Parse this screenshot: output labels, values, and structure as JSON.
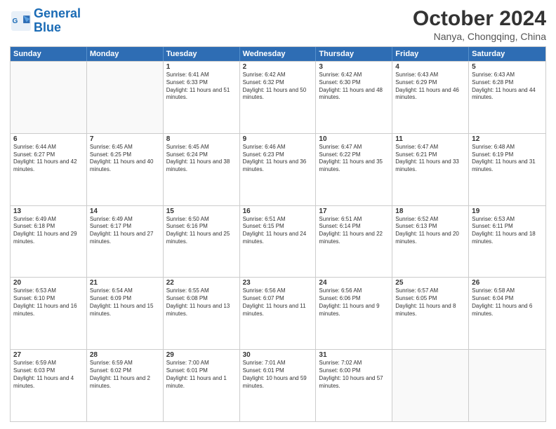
{
  "header": {
    "logo_line1": "General",
    "logo_line2": "Blue",
    "month": "October 2024",
    "location": "Nanya, Chongqing, China"
  },
  "weekdays": [
    "Sunday",
    "Monday",
    "Tuesday",
    "Wednesday",
    "Thursday",
    "Friday",
    "Saturday"
  ],
  "rows": [
    [
      {
        "day": "",
        "info": "",
        "empty": true
      },
      {
        "day": "",
        "info": "",
        "empty": true
      },
      {
        "day": "1",
        "info": "Sunrise: 6:41 AM\nSunset: 6:33 PM\nDaylight: 11 hours and 51 minutes."
      },
      {
        "day": "2",
        "info": "Sunrise: 6:42 AM\nSunset: 6:32 PM\nDaylight: 11 hours and 50 minutes."
      },
      {
        "day": "3",
        "info": "Sunrise: 6:42 AM\nSunset: 6:30 PM\nDaylight: 11 hours and 48 minutes."
      },
      {
        "day": "4",
        "info": "Sunrise: 6:43 AM\nSunset: 6:29 PM\nDaylight: 11 hours and 46 minutes."
      },
      {
        "day": "5",
        "info": "Sunrise: 6:43 AM\nSunset: 6:28 PM\nDaylight: 11 hours and 44 minutes."
      }
    ],
    [
      {
        "day": "6",
        "info": "Sunrise: 6:44 AM\nSunset: 6:27 PM\nDaylight: 11 hours and 42 minutes."
      },
      {
        "day": "7",
        "info": "Sunrise: 6:45 AM\nSunset: 6:25 PM\nDaylight: 11 hours and 40 minutes."
      },
      {
        "day": "8",
        "info": "Sunrise: 6:45 AM\nSunset: 6:24 PM\nDaylight: 11 hours and 38 minutes."
      },
      {
        "day": "9",
        "info": "Sunrise: 6:46 AM\nSunset: 6:23 PM\nDaylight: 11 hours and 36 minutes."
      },
      {
        "day": "10",
        "info": "Sunrise: 6:47 AM\nSunset: 6:22 PM\nDaylight: 11 hours and 35 minutes."
      },
      {
        "day": "11",
        "info": "Sunrise: 6:47 AM\nSunset: 6:21 PM\nDaylight: 11 hours and 33 minutes."
      },
      {
        "day": "12",
        "info": "Sunrise: 6:48 AM\nSunset: 6:19 PM\nDaylight: 11 hours and 31 minutes."
      }
    ],
    [
      {
        "day": "13",
        "info": "Sunrise: 6:49 AM\nSunset: 6:18 PM\nDaylight: 11 hours and 29 minutes."
      },
      {
        "day": "14",
        "info": "Sunrise: 6:49 AM\nSunset: 6:17 PM\nDaylight: 11 hours and 27 minutes."
      },
      {
        "day": "15",
        "info": "Sunrise: 6:50 AM\nSunset: 6:16 PM\nDaylight: 11 hours and 25 minutes."
      },
      {
        "day": "16",
        "info": "Sunrise: 6:51 AM\nSunset: 6:15 PM\nDaylight: 11 hours and 24 minutes."
      },
      {
        "day": "17",
        "info": "Sunrise: 6:51 AM\nSunset: 6:14 PM\nDaylight: 11 hours and 22 minutes."
      },
      {
        "day": "18",
        "info": "Sunrise: 6:52 AM\nSunset: 6:13 PM\nDaylight: 11 hours and 20 minutes."
      },
      {
        "day": "19",
        "info": "Sunrise: 6:53 AM\nSunset: 6:11 PM\nDaylight: 11 hours and 18 minutes."
      }
    ],
    [
      {
        "day": "20",
        "info": "Sunrise: 6:53 AM\nSunset: 6:10 PM\nDaylight: 11 hours and 16 minutes."
      },
      {
        "day": "21",
        "info": "Sunrise: 6:54 AM\nSunset: 6:09 PM\nDaylight: 11 hours and 15 minutes."
      },
      {
        "day": "22",
        "info": "Sunrise: 6:55 AM\nSunset: 6:08 PM\nDaylight: 11 hours and 13 minutes."
      },
      {
        "day": "23",
        "info": "Sunrise: 6:56 AM\nSunset: 6:07 PM\nDaylight: 11 hours and 11 minutes."
      },
      {
        "day": "24",
        "info": "Sunrise: 6:56 AM\nSunset: 6:06 PM\nDaylight: 11 hours and 9 minutes."
      },
      {
        "day": "25",
        "info": "Sunrise: 6:57 AM\nSunset: 6:05 PM\nDaylight: 11 hours and 8 minutes."
      },
      {
        "day": "26",
        "info": "Sunrise: 6:58 AM\nSunset: 6:04 PM\nDaylight: 11 hours and 6 minutes."
      }
    ],
    [
      {
        "day": "27",
        "info": "Sunrise: 6:59 AM\nSunset: 6:03 PM\nDaylight: 11 hours and 4 minutes."
      },
      {
        "day": "28",
        "info": "Sunrise: 6:59 AM\nSunset: 6:02 PM\nDaylight: 11 hours and 2 minutes."
      },
      {
        "day": "29",
        "info": "Sunrise: 7:00 AM\nSunset: 6:01 PM\nDaylight: 11 hours and 1 minute."
      },
      {
        "day": "30",
        "info": "Sunrise: 7:01 AM\nSunset: 6:01 PM\nDaylight: 10 hours and 59 minutes."
      },
      {
        "day": "31",
        "info": "Sunrise: 7:02 AM\nSunset: 6:00 PM\nDaylight: 10 hours and 57 minutes."
      },
      {
        "day": "",
        "info": "",
        "empty": true
      },
      {
        "day": "",
        "info": "",
        "empty": true
      }
    ]
  ]
}
